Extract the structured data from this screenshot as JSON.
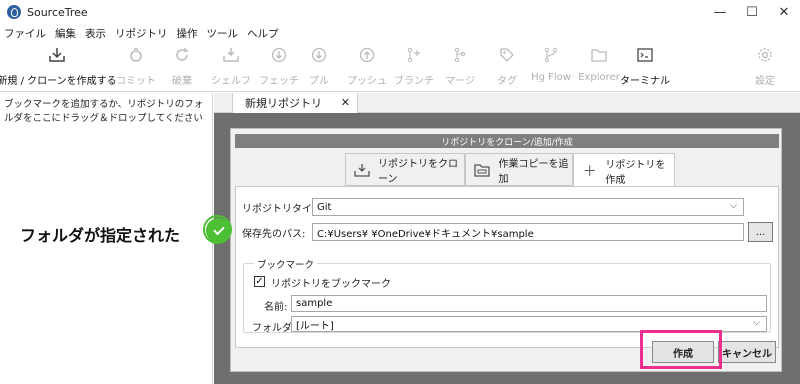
{
  "window": {
    "title": "SourceTree",
    "controls": [
      "—",
      "☐",
      "✕"
    ]
  },
  "menubar": [
    "ファイル",
    "編集",
    "表示",
    "リポジトリ",
    "操作",
    "ツール",
    "ヘルプ"
  ],
  "toolbar": [
    {
      "label": "新規 / クローンを作成する",
      "icon": "new-clone-icon",
      "active": true
    },
    {
      "label": "コミット",
      "icon": "commit-icon",
      "active": false
    },
    {
      "label": "破棄",
      "icon": "discard-icon",
      "active": false
    },
    {
      "label": "シェルフ",
      "icon": "shelve-icon",
      "active": false
    },
    {
      "label": "フェッチ",
      "icon": "fetch-icon",
      "active": false
    },
    {
      "label": "プル",
      "icon": "pull-icon",
      "active": false
    },
    {
      "label": "プッシュ",
      "icon": "push-icon",
      "active": false
    },
    {
      "label": "ブランチ",
      "icon": "branch-icon",
      "active": false
    },
    {
      "label": "マージ",
      "icon": "merge-icon",
      "active": false
    },
    {
      "label": "タグ",
      "icon": "tag-icon",
      "active": false
    },
    {
      "label": "Hg Flow",
      "icon": "hgflow-icon",
      "active": false
    },
    {
      "label": "Explorer",
      "icon": "folder-icon",
      "active": false
    },
    {
      "label": "ターミナル",
      "icon": "terminal-icon",
      "active": true
    },
    {
      "label": "設定",
      "icon": "gear-icon",
      "active": false
    }
  ],
  "left_panel": {
    "hint": "ブックマークを追加するか、リポジトリのフォルダをここにドラッグ＆ドロップしてください"
  },
  "document_tab": {
    "label": "新規リポジトリ",
    "close": "✕"
  },
  "dialog": {
    "header": "リポジトリをクローン/追加/作成",
    "tabs": [
      "リポジトリをクローン",
      "作業コピーを追加",
      "リポジトリを作成"
    ],
    "repo_type_label": "リポジトリタイプ:",
    "repo_type_value": "Git",
    "path_label": "保存先のパス:",
    "path_value": "C:¥Users¥           ¥OneDrive¥ドキュメント¥sample",
    "browse_label": "...",
    "bookmark_group_title": "ブックマーク",
    "bookmark_checkbox_label": "リポジトリをブックマーク",
    "bookmark_checked": true,
    "name_label": "名前:",
    "name_value": "sample",
    "folder_label": "フォルダ:",
    "folder_value": "[ルート]",
    "create_button": "作成",
    "cancel_button": "キャンセル"
  },
  "annotation": {
    "text": "フォルダが指定された",
    "highlight_color": "#ec2f8e",
    "check_color": "#4cbf35"
  }
}
